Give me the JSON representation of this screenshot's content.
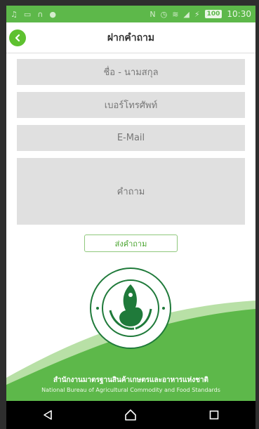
{
  "status_bar": {
    "battery": "100",
    "time": "10:30",
    "icons": [
      "music-icon",
      "image-icon",
      "headphones-icon",
      "android-icon",
      "nfc-icon",
      "alarm-icon",
      "wifi-icon",
      "signal-icon",
      "charging-icon"
    ]
  },
  "header": {
    "title": "ฝากคำถาม",
    "back_icon": "chevron-left-icon"
  },
  "form": {
    "name_placeholder": "ชื่อ - นามสกุล",
    "phone_placeholder": "เบอร์โทรศัพท์",
    "email_placeholder": "E-Mail",
    "question_placeholder": "คำถาม",
    "submit_label": "ส่งคำถาม"
  },
  "footer": {
    "org_th": "สำนักงานมาตรฐานสินค้าเกษตรและอาหารแห่งชาติ",
    "org_en": "National Bureau of Agricultural Commodity and Food Standards"
  },
  "nav": {
    "back": "back-icon",
    "home": "home-icon",
    "recents": "recents-icon"
  },
  "colors": {
    "brand_green": "#5db84a",
    "accent_green": "#5ec130",
    "field_gray": "#e0e0e0"
  }
}
